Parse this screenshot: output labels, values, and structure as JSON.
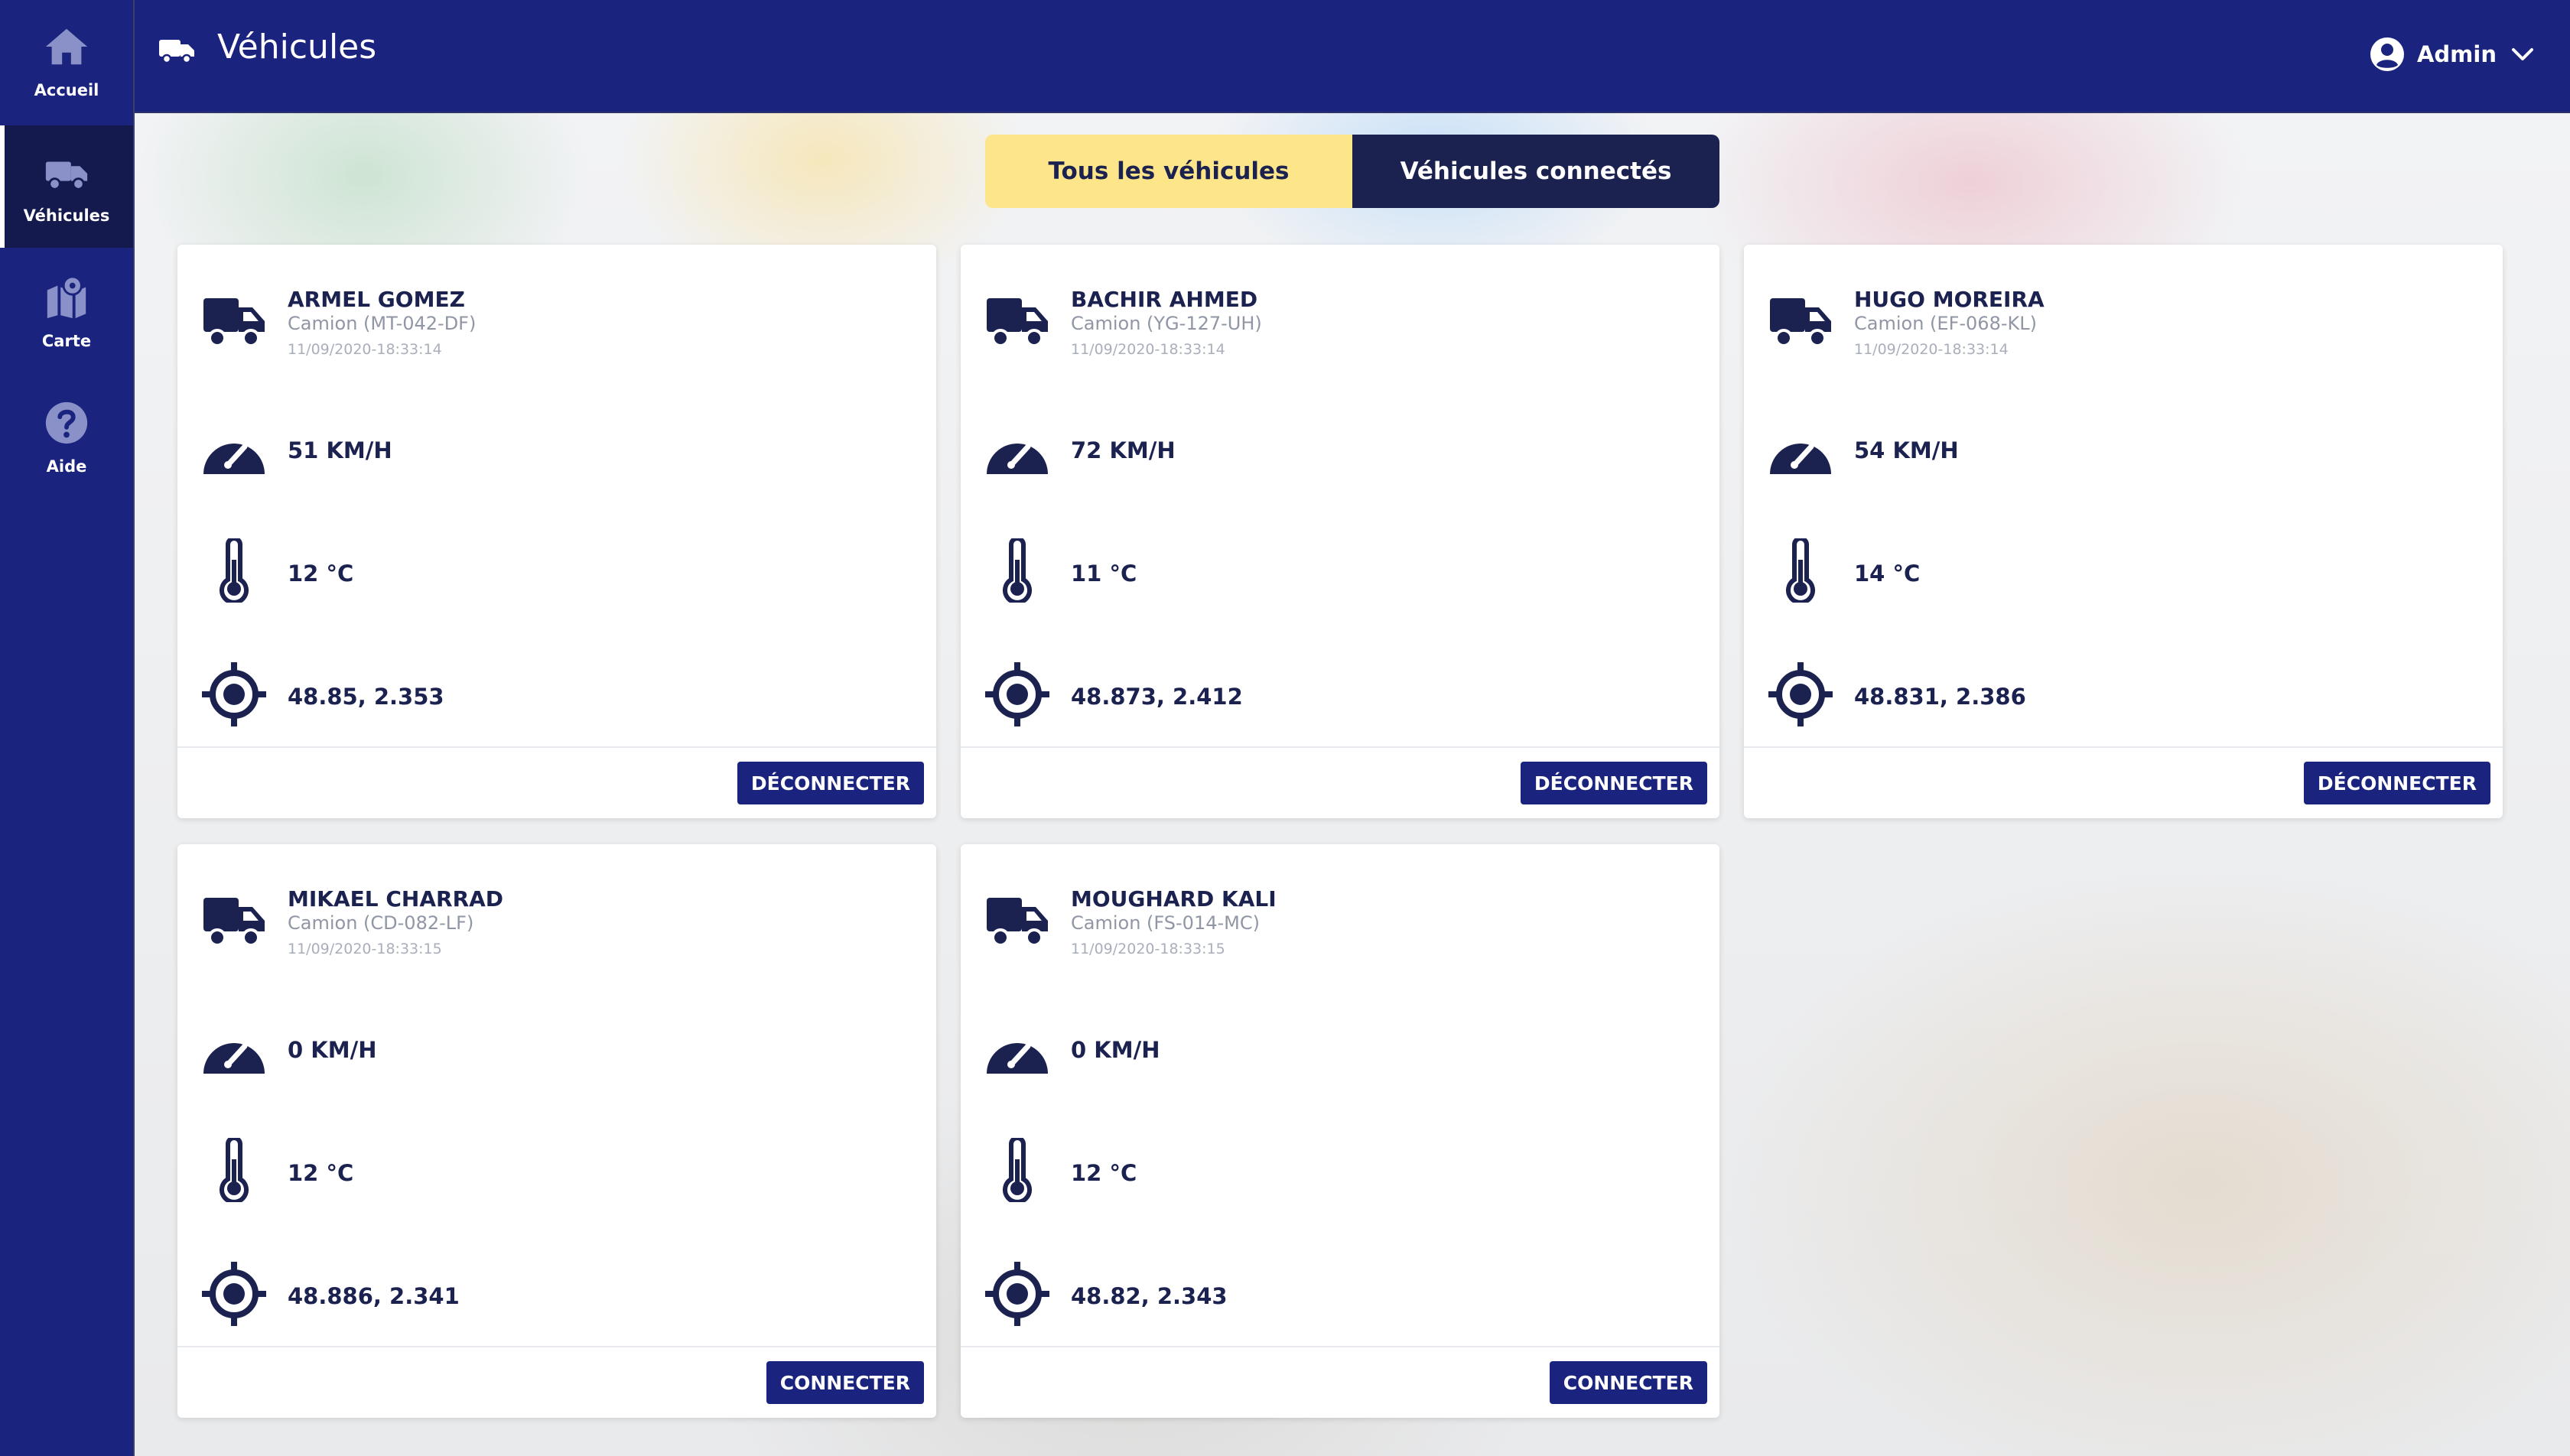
{
  "sidebar": {
    "items": [
      {
        "label": "Accueil",
        "icon": "home-icon"
      },
      {
        "label": "Véhicules",
        "icon": "truck-icon",
        "active": true
      },
      {
        "label": "Carte",
        "icon": "map-pin-icon"
      },
      {
        "label": "Aide",
        "icon": "question-circle-icon"
      }
    ]
  },
  "header": {
    "title": "Véhicules",
    "icon": "truck-icon",
    "user": {
      "name": "Admin",
      "icon": "user-circle-icon",
      "chevron": "chevron-down-icon"
    }
  },
  "tabs": [
    {
      "label": "Tous les véhicules",
      "active": true,
      "color": "#fde68a"
    },
    {
      "label": "Véhicules connectés",
      "active": false,
      "color": "#1c2250"
    }
  ],
  "colors": {
    "primary": "#1a237e",
    "sidebar_active": "#141a4e",
    "tab_active": "#fde68a",
    "ink": "#1c2250"
  },
  "vehicles": [
    {
      "driver": "ARMEL GOMEZ",
      "vehicle": "Camion (MT-042-DF)",
      "timestamp": "11/09/2020-18:33:14",
      "speed": "51 KM/H",
      "temperature": "12 °C",
      "position": "48.85, 2.353",
      "action": "DÉCONNECTER"
    },
    {
      "driver": "BACHIR AHMED",
      "vehicle": "Camion (YG-127-UH)",
      "timestamp": "11/09/2020-18:33:14",
      "speed": "72 KM/H",
      "temperature": "11 °C",
      "position": "48.873, 2.412",
      "action": "DÉCONNECTER"
    },
    {
      "driver": "HUGO MOREIRA",
      "vehicle": "Camion (EF-068-KL)",
      "timestamp": "11/09/2020-18:33:14",
      "speed": "54 KM/H",
      "temperature": "14 °C",
      "position": "48.831, 2.386",
      "action": "DÉCONNECTER"
    },
    {
      "driver": "MIKAEL CHARRAD",
      "vehicle": "Camion (CD-082-LF)",
      "timestamp": "11/09/2020-18:33:15",
      "speed": "0 KM/H",
      "temperature": "12 °C",
      "position": "48.886, 2.341",
      "action": "CONNECTER"
    },
    {
      "driver": "MOUGHARD KALI",
      "vehicle": "Camion (FS-014-MC)",
      "timestamp": "11/09/2020-18:33:15",
      "speed": "0 KM/H",
      "temperature": "12 °C",
      "position": "48.82, 2.343",
      "action": "CONNECTER"
    }
  ]
}
